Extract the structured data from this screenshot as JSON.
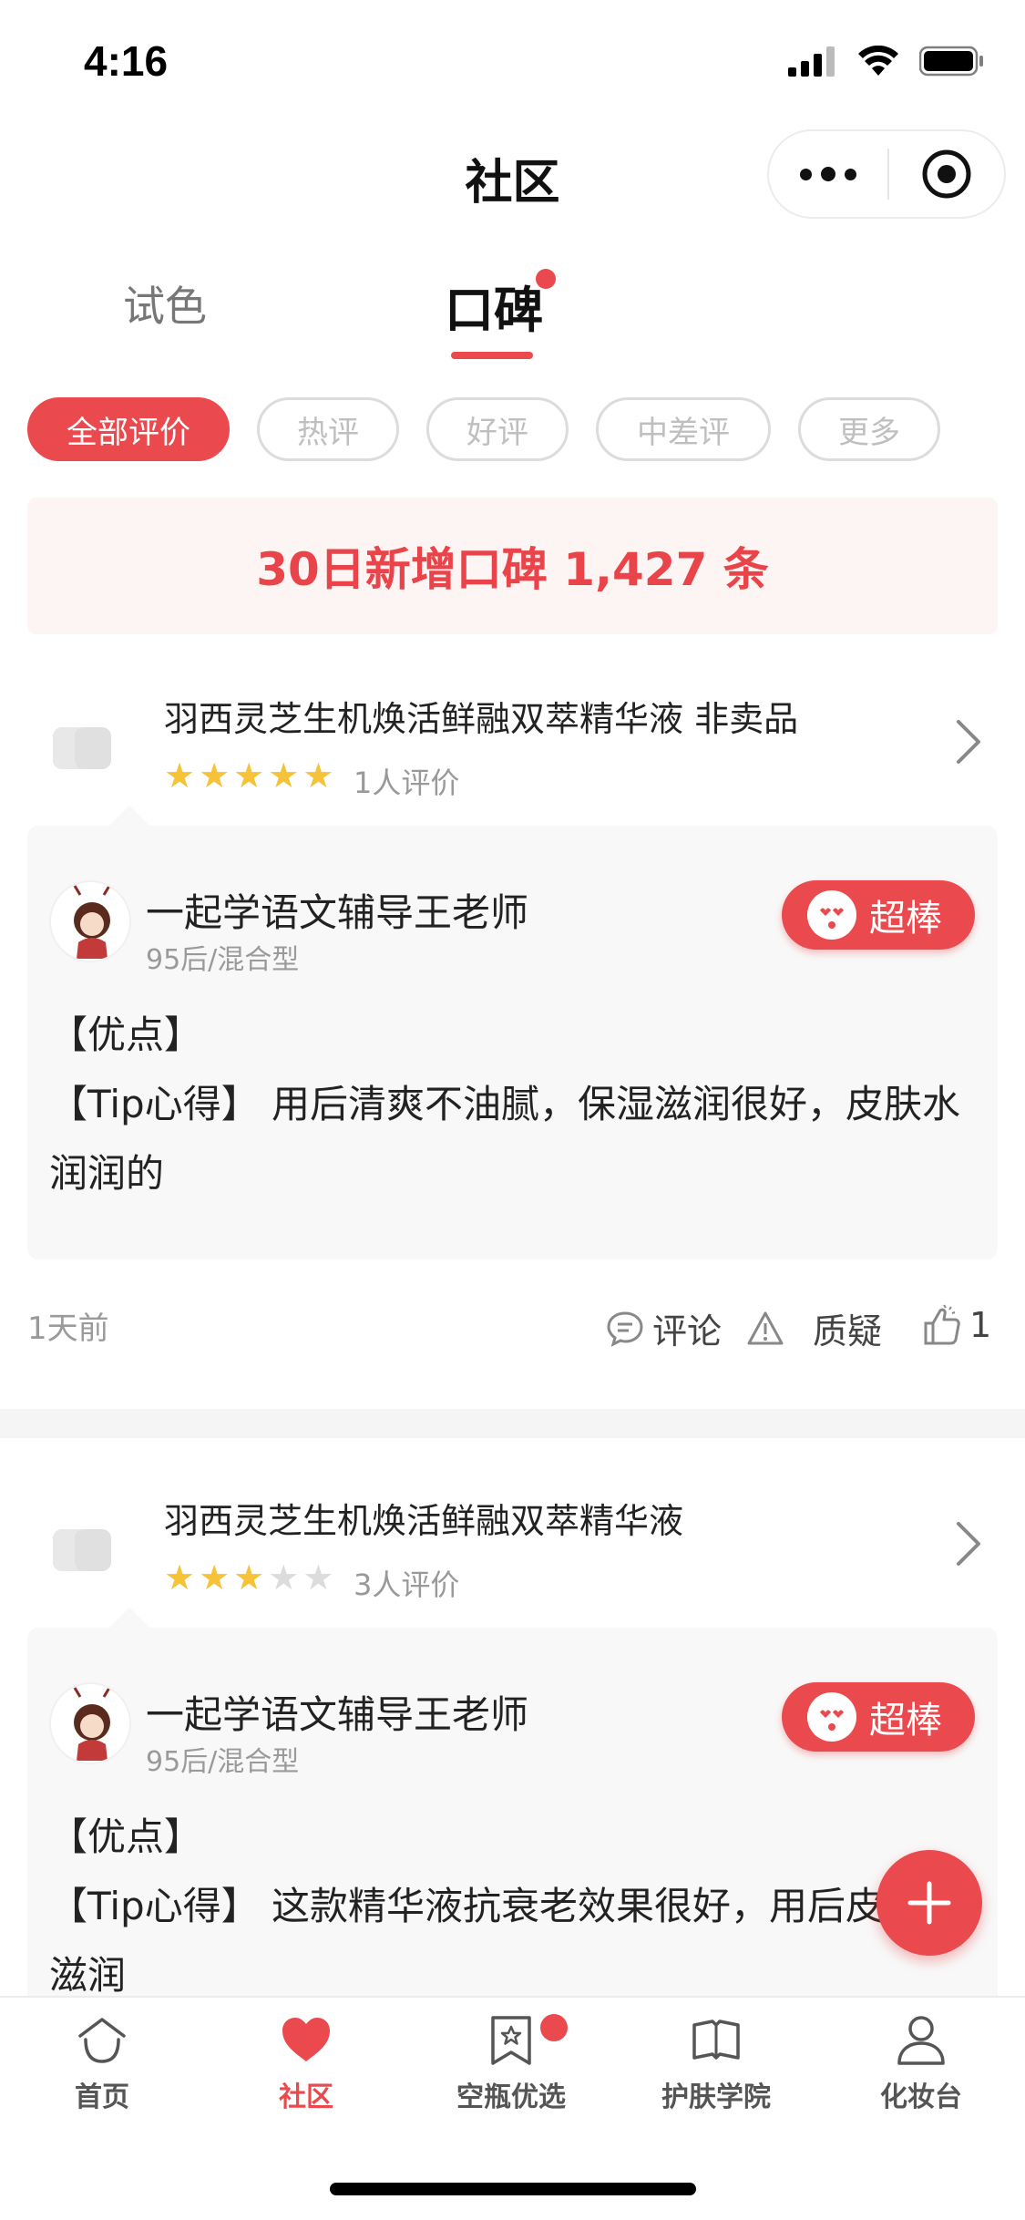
{
  "status_bar": {
    "time": "4:16"
  },
  "nav": {
    "title": "社区"
  },
  "tabs": [
    {
      "label": "试色"
    },
    {
      "label": "口碑"
    }
  ],
  "filters": [
    "全部评价",
    "热评",
    "好评",
    "中差评",
    "更多"
  ],
  "banner": {
    "text": "30日新增口碑 1,427 条"
  },
  "reviews": [
    {
      "product": {
        "name": "羽西灵芝生机焕活鲜融双萃精华液 非卖品",
        "stars": 5,
        "rating_count": "1人评价"
      },
      "user": {
        "name": "一起学语文辅导王老师",
        "meta": "95后/混合型"
      },
      "badge": "超棒",
      "lines": [
        "【优点】",
        "【Tip心得】 用后清爽不油腻，保湿滋润很好，皮肤水润润的"
      ],
      "time": "1天前",
      "actions": {
        "comment": "评论",
        "doubt": "质疑",
        "likes": "1"
      }
    },
    {
      "product": {
        "name": "羽西灵芝生机焕活鲜融双萃精华液",
        "stars": 3,
        "rating_count": "3人评价"
      },
      "user": {
        "name": "一起学语文辅导王老师",
        "meta": "95后/混合型"
      },
      "badge": "超棒",
      "lines": [
        "【优点】",
        "【Tip心得】 这款精华液抗衰老效果很好，用后皮肤很滋润"
      ]
    }
  ],
  "tabbar": [
    {
      "label": "首页",
      "icon": "home-icon"
    },
    {
      "label": "社区",
      "icon": "heart-icon"
    },
    {
      "label": "空瓶优选",
      "icon": "bookmark-star-icon"
    },
    {
      "label": "护肤学院",
      "icon": "book-icon"
    },
    {
      "label": "化妆台",
      "icon": "user-icon"
    }
  ],
  "colors": {
    "accent": "#ea4a4e",
    "star": "#f6c338",
    "banner_bg": "#fdf5f4"
  }
}
